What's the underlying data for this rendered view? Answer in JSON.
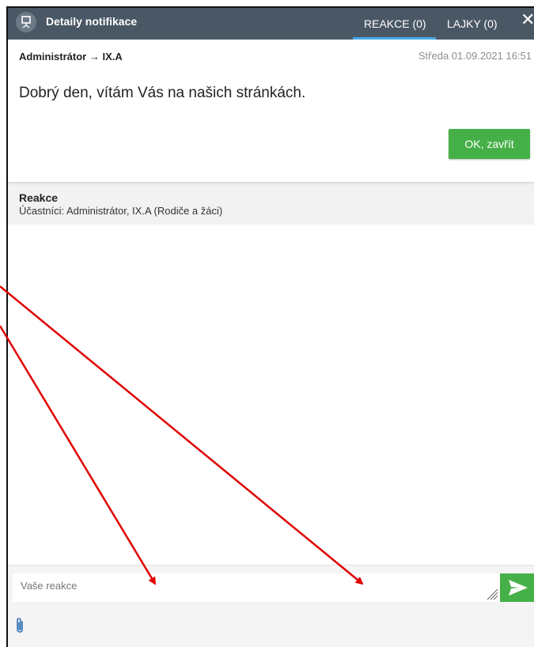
{
  "header": {
    "title": "Detaily notifikace",
    "tabs": [
      {
        "label": "REAKCE (0)",
        "active": true
      },
      {
        "label": "LAJKY (0)",
        "active": false
      }
    ],
    "close_symbol": "✕",
    "icon": "presentation-board-icon",
    "background": "#4a5865",
    "active_tab_color": "#4aa8e6"
  },
  "message": {
    "route": "Administrátor → IX.A",
    "timestamp": "Středa 01.09.2021 16:51",
    "text": "Dobrý den, vítám Vás na našich stránkách.",
    "ok_label": "OK, zavřít"
  },
  "reactions": {
    "title": "Reakce",
    "participants": "Účastníci: Administrátor, IX.A (Rodiče a žáci)"
  },
  "composer": {
    "placeholder": "Vaše reakce",
    "send_icon": "send-icon",
    "attach_icon": "paperclip-icon"
  },
  "colors": {
    "accent_green": "#45b048",
    "annotation_red": "#e00000"
  }
}
